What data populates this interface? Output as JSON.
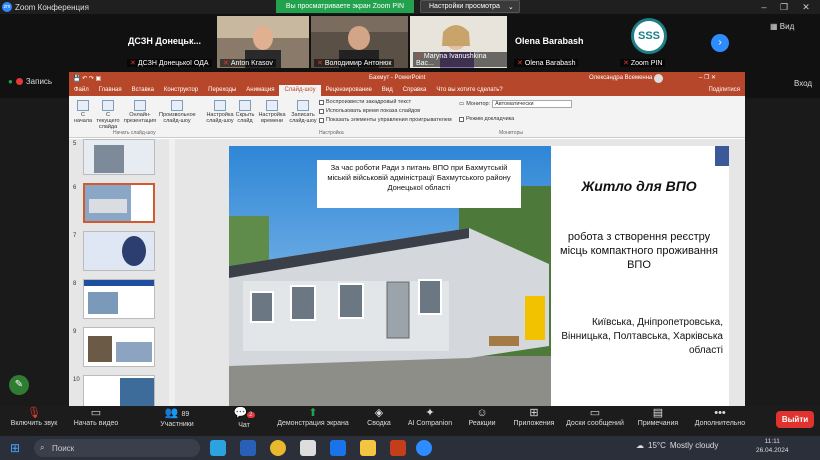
{
  "zoom": {
    "window_title": "Zoom Конференция",
    "share_banner": "Вы просматриваете экран Zoom PIN",
    "view_options": "Настройки просмотра",
    "view_button": "Вид",
    "recording": "Запись",
    "exit_top": "Вход"
  },
  "participants": [
    {
      "tile_name": "ДСЗН  Донецьк...",
      "label": "ДСЗН Донецької ОДА",
      "muted": true
    },
    {
      "tile_name": "",
      "label": "Anton Krasov",
      "muted": true
    },
    {
      "tile_name": "",
      "label": "Володимир Антонюк",
      "muted": true
    },
    {
      "tile_name": "",
      "label": "Maryna Ivanushkina Вас...",
      "muted": true
    },
    {
      "tile_name": "Olena Barabash",
      "label": "Olena Barabash",
      "muted": true
    },
    {
      "tile_name": "SSS",
      "label": "Zoom PIN",
      "muted": true
    }
  ],
  "powerpoint": {
    "title": "Бахмут - PowerPoint",
    "user": "Олександра Всеменна",
    "share_label": "Поділитися",
    "tabs": [
      "Файл",
      "Главная",
      "Вставка",
      "Конструктор",
      "Переходы",
      "Анимация",
      "Слайд-шоу",
      "Рецензирование",
      "Вид",
      "Справка",
      "Что вы хотите сделать?"
    ],
    "active_tab": "Слайд-шоу",
    "ribbon": {
      "from_start": "С начала",
      "from_current": "С текущего слайда",
      "online": "Онлайн-презентация",
      "custom": "Произвольное слайд-шоу",
      "group_start": "Начать слайд-шоу",
      "setup": "Настройка слайд-шоу",
      "hide": "Скрыть слайд",
      "rehearse": "Настройка времени",
      "record": "Записать слайд-шоу",
      "chk1": "Воспроизвести закадровый текст",
      "chk2": "Использовать время показа слайдов",
      "chk3": "Показать элементы управления проигрывателем",
      "group_setup": "Настройка",
      "monitor_label": "Монитор:",
      "monitor_value": "Автоматически",
      "presenter": "Режим докладчика",
      "group_monitors": "Мониторы"
    },
    "thumbnails": [
      "5",
      "6",
      "7",
      "8",
      "9",
      "10"
    ]
  },
  "slide": {
    "caption": "За час роботи Ради з питань ВПО при Бахмутській міській військовій адміністрації Бахмутського району Донецької області",
    "heading": "Житло для ВПО",
    "body": "робота з створення реєстру місць компактного проживання ВПО",
    "regions": "Київська, Дніпропетровська, Вінницька, Полтавська, Харківська області"
  },
  "toolbar": {
    "unmute": "Включить звук",
    "video": "Начать видео",
    "participants": "Участники",
    "participants_count": "89",
    "chat": "Чат",
    "chat_badge": "2",
    "share": "Демонстрация экрана",
    "summary": "Сводка",
    "companion": "AI Companion",
    "reactions": "Реакции",
    "apps": "Приложения",
    "whiteboards": "Доски сообщений",
    "notes": "Примечания",
    "more": "Дополнительно",
    "leave": "Выйти"
  },
  "taskbar": {
    "search": "Поиск",
    "weather_temp": "15°C",
    "weather_desc": "Mostly cloudy",
    "time": "11:11",
    "date": "26.04.2024"
  },
  "colors": {
    "ppt_accent": "#b7472a",
    "zoom_blue": "#2d8cff",
    "share_green": "#23a24d",
    "leave_red": "#e0322f"
  }
}
